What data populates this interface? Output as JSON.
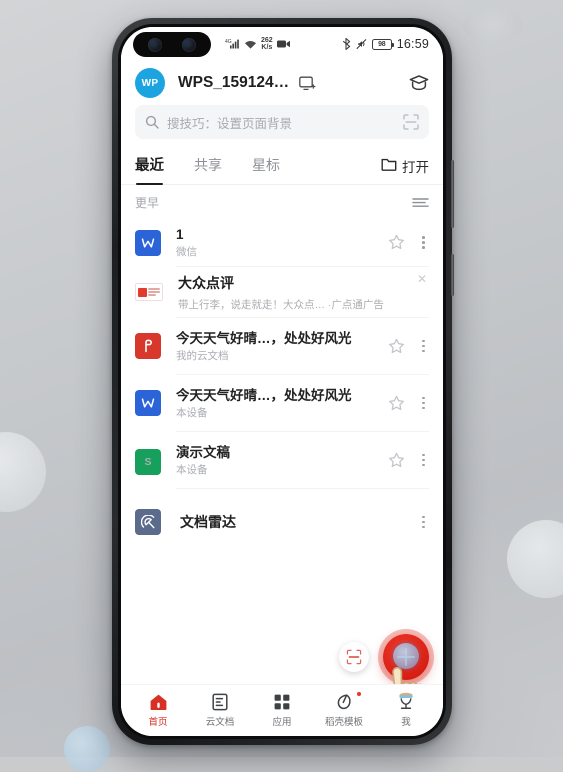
{
  "status_bar": {
    "network_label": "4G",
    "net_speed_value": "262",
    "net_speed_unit": "K/s",
    "battery_level": "98",
    "time": "16:59",
    "icons": [
      "signal-icon",
      "wifi-icon",
      "video-record-icon",
      "bluetooth-icon",
      "mute-icon",
      "battery-icon"
    ]
  },
  "header": {
    "avatar_text": "WP",
    "document_title": "WPS_159124…",
    "cast_icon": "cast-screen-icon",
    "learn_icon": "graduation-cap-icon"
  },
  "search": {
    "placeholder": "搜技巧：设置页面背景",
    "search_icon": "search-icon",
    "scan_icon": "scan-document-icon"
  },
  "tabs": {
    "items": [
      {
        "label": "最近",
        "active": true
      },
      {
        "label": "共享",
        "active": false
      },
      {
        "label": "星标",
        "active": false
      }
    ],
    "open_label": "打开",
    "open_icon": "folder-icon"
  },
  "section": {
    "label": "更早",
    "filter_icon": "filter-sort-icon"
  },
  "list": {
    "rows": [
      {
        "type": "file",
        "icon": "word-file-icon",
        "icon_kind": "w",
        "icon_glyph": "W",
        "title": "1",
        "subtitle": "微信"
      },
      {
        "type": "ad",
        "icon": "dianping-ad-icon",
        "title": "大众点评",
        "subtitle": "带上行李，说走就走！大众点… ·广点通广告",
        "close_icon": "close-icon"
      },
      {
        "type": "file",
        "icon": "pdf-file-icon",
        "icon_kind": "p",
        "icon_glyph": "P",
        "title": "今天天气好晴…，处处好风光",
        "subtitle": "我的云文档"
      },
      {
        "type": "file",
        "icon": "word-file-icon",
        "icon_kind": "w",
        "icon_glyph": "W",
        "title": "今天天气好晴…，处处好风光",
        "subtitle": "本设备"
      },
      {
        "type": "file",
        "icon": "spreadsheet-file-icon",
        "icon_kind": "s",
        "icon_glyph": "S",
        "title": "演示文稿",
        "subtitle": "本设备"
      },
      {
        "type": "tool",
        "icon": "document-radar-icon",
        "icon_kind": "radar",
        "title": "文档雷达",
        "subtitle": ""
      }
    ],
    "star_icon": "star-outline-icon",
    "more_icon": "more-vertical-icon"
  },
  "fab": {
    "scan_label": "scan-fab",
    "scan_icon": "scan-frame-icon",
    "new_label": "new-document-fab",
    "new_icon": "plus-icon",
    "cursor_icon": "hand-cursor-icon"
  },
  "bottom_nav": {
    "items": [
      {
        "label": "首页",
        "icon": "home-icon",
        "active": true,
        "badge": false
      },
      {
        "label": "云文档",
        "icon": "cloud-document-icon",
        "active": false,
        "badge": false
      },
      {
        "label": "应用",
        "icon": "apps-grid-icon",
        "active": false,
        "badge": false
      },
      {
        "label": "稻壳模板",
        "icon": "template-leaf-icon",
        "active": false,
        "badge": true
      },
      {
        "label": "我",
        "icon": "profile-avatar-icon",
        "active": false,
        "badge": false
      }
    ]
  },
  "colors": {
    "accent_red": "#d93025",
    "word_blue": "#2a64d6",
    "pdf_red": "#d8382c",
    "sheet_green": "#17a05c",
    "avatar_blue": "#1ba4e0",
    "radar_slate": "#5b6b8c"
  }
}
